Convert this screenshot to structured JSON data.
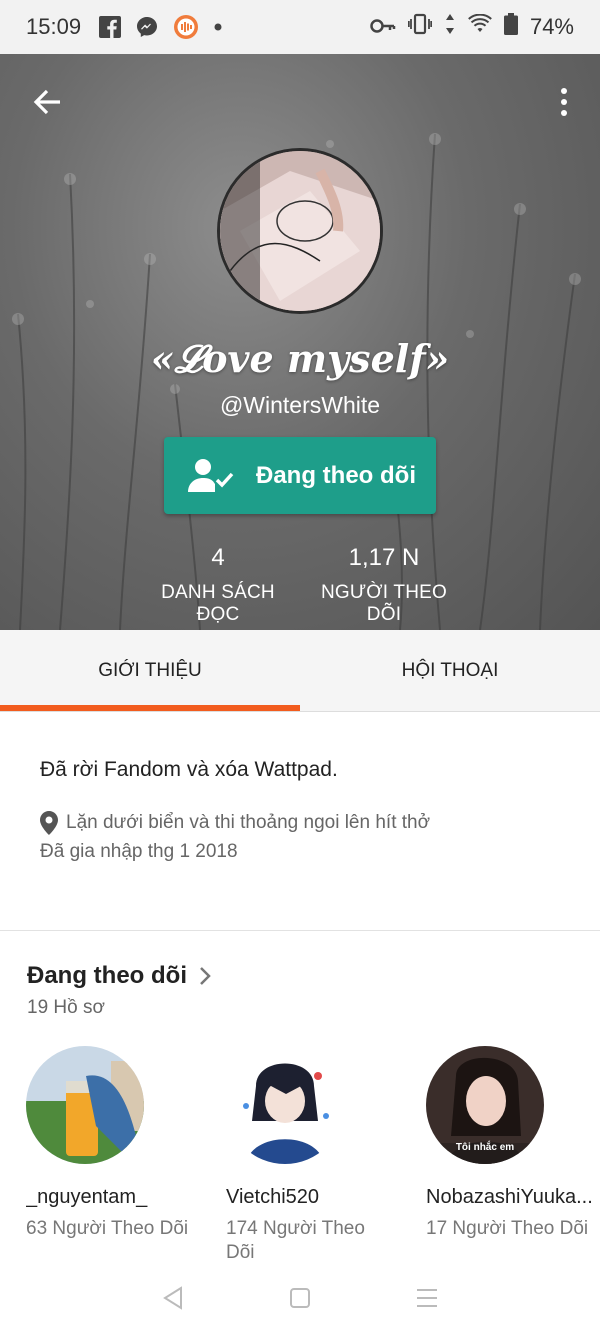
{
  "status_bar": {
    "time": "15:09",
    "battery": "74%",
    "icons": [
      "facebook-icon",
      "messenger-icon",
      "podcast-icon",
      "dot-icon",
      "key-icon",
      "vibrate-icon",
      "data-icon",
      "wifi-icon",
      "battery-icon"
    ]
  },
  "header": {
    "back_icon": "back-arrow-icon",
    "menu_icon": "more-vert-icon"
  },
  "profile": {
    "display_name": "«𝓛ove myself»",
    "handle": "@WintersWhite",
    "follow_button_label": "Đang theo dõi",
    "stats": [
      {
        "value": "4",
        "label": "DANH SÁCH ĐỌC"
      },
      {
        "value": "1,17 N",
        "label": "NGƯỜI THEO DÕI"
      }
    ]
  },
  "tabs": [
    {
      "label": "GIỚI THIỆU",
      "active": true
    },
    {
      "label": "HỘI THOẠI",
      "active": false
    }
  ],
  "about": {
    "bio": "Đã rời Fandom và xóa Wattpad.",
    "location": "Lặn dưới biển và thi thoảng ngoi lên hít thở",
    "joined": "Đã gia nhập thg 1 2018"
  },
  "following": {
    "title": "Đang theo dõi",
    "count": "19 Hồ sơ",
    "profiles": [
      {
        "name": "_nguyentam_",
        "followers": "63 Người Theo Dõi"
      },
      {
        "name": "Vietchi520",
        "followers": "174 Người Theo Dõi"
      },
      {
        "name": "NobazashiYuuka...",
        "followers": "17 Người Theo Dõi",
        "avatar_caption": "Tôi nhắc em"
      }
    ]
  },
  "colors": {
    "accent_orange": "#f25c1e",
    "follow_teal": "#1e9e8a"
  }
}
